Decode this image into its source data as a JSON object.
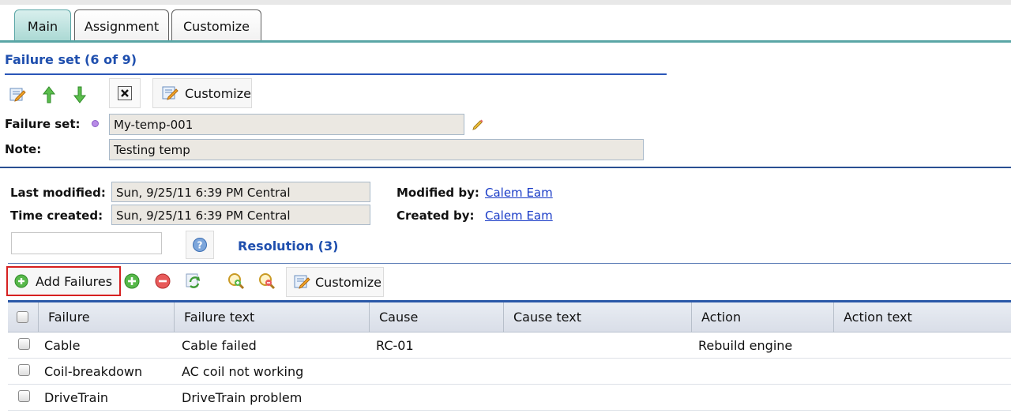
{
  "tabs": [
    {
      "label": "Main",
      "active": true
    },
    {
      "label": "Assignment",
      "active": false
    },
    {
      "label": "Customize",
      "active": false
    }
  ],
  "header": {
    "title": "Failure set (6 of 9)"
  },
  "toolbar": {
    "customize_label": "Customize"
  },
  "form": {
    "failure_set_label": "Failure set:",
    "failure_set_value": "My-temp-001",
    "note_label": "Note:",
    "note_value": "Testing temp"
  },
  "audit": {
    "last_modified_label": "Last modified:",
    "last_modified_value": "Sun, 9/25/11 6:39 PM Central",
    "time_created_label": "Time created:",
    "time_created_value": "Sun, 9/25/11 6:39 PM Central",
    "modified_by_label": "Modified by:",
    "modified_by_value": "Calem Eam",
    "created_by_label": "Created by:",
    "created_by_value": "Calem Eam"
  },
  "resolution": {
    "search_value": "",
    "title": "Resolution (3)"
  },
  "grid_toolbar": {
    "add_failures_label": "Add Failures",
    "customize_label": "Customize"
  },
  "grid": {
    "columns": [
      "Failure",
      "Failure text",
      "Cause",
      "Cause text",
      "Action",
      "Action text"
    ],
    "rows": [
      {
        "failure": "Cable",
        "failure_text": "Cable failed",
        "cause": "RC-01",
        "cause_text": "",
        "action": "Rebuild engine",
        "action_text": ""
      },
      {
        "failure": "Coil-breakdown",
        "failure_text": "AC coil not working",
        "cause": "",
        "cause_text": "",
        "action": "",
        "action_text": ""
      },
      {
        "failure": "DriveTrain",
        "failure_text": "DriveTrain problem",
        "cause": "",
        "cause_text": "",
        "action": "",
        "action_text": ""
      }
    ]
  },
  "colors": {
    "accent": "#2a56b8",
    "tab_active": "#a9d8d3",
    "highlight_box": "#d62020",
    "link": "#1a3cc7"
  }
}
